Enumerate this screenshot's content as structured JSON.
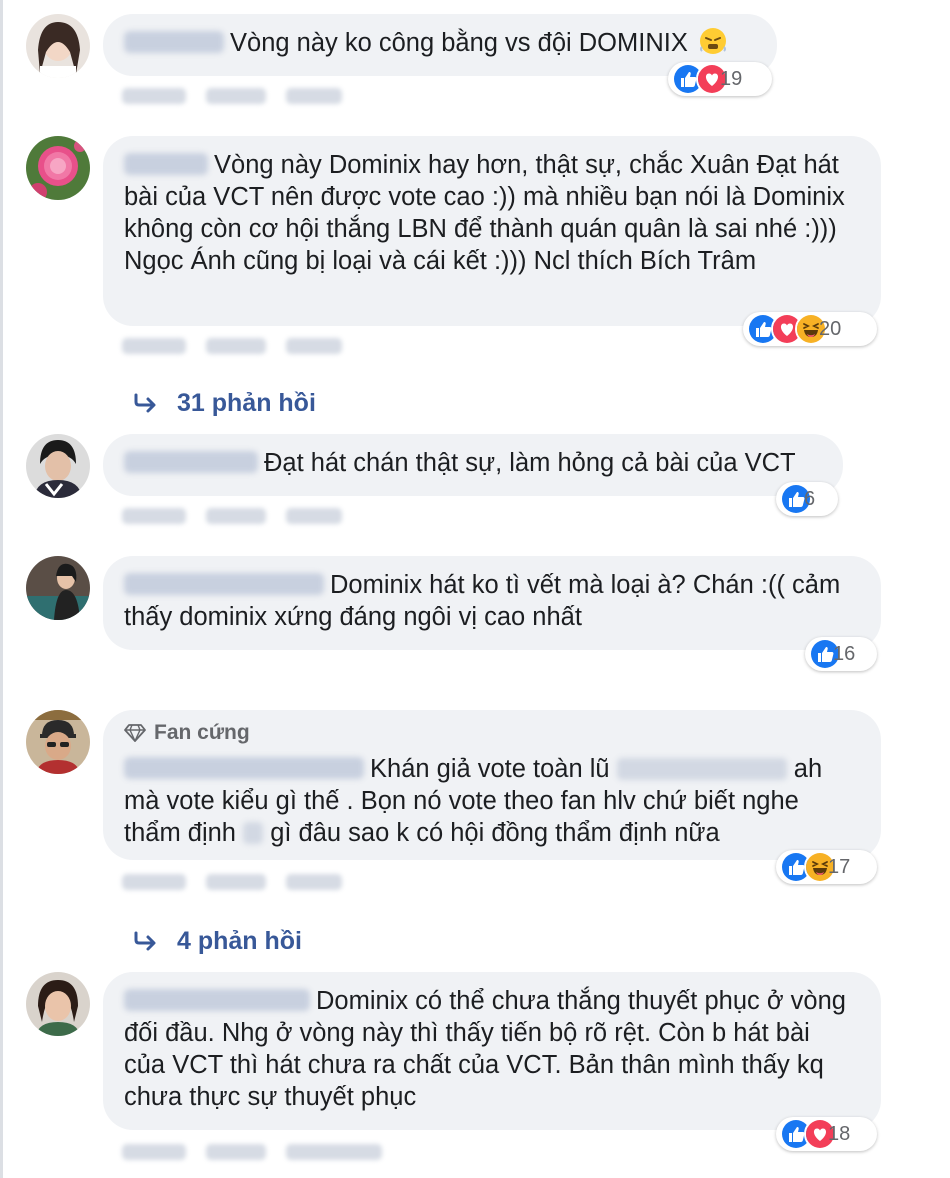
{
  "comments": [
    {
      "text": "Vòng này ko công bằng vs đội DOMINIX",
      "reaction_count": "19",
      "reactions": [
        "like-icon",
        "love-icon"
      ]
    },
    {
      "text": "Vòng này Dominix hay hơn, thật sự, chắc Xuân Đạt hát bài của VCT nên được vote cao :)) mà nhiều bạn nói là Dominix không còn cơ hội thắng LBN để thành quán quân là sai nhé :))) Ngọc Ánh cũng bị loại và cái kết :))) Ncl thích Bích Trâm",
      "reaction_count": "20",
      "reactions": [
        "like-icon",
        "love-icon",
        "haha-icon"
      ],
      "replies_label": "31 phản hồi"
    },
    {
      "text": "Đạt hát chán thật sự, làm hỏng cả bài của VCT",
      "reaction_count": "6",
      "reactions": [
        "like-icon"
      ]
    },
    {
      "text": "Dominix hát ko tì vết mà loại à? Chán :(( cảm thấy dominix xứng đáng ngôi vị cao nhất",
      "reaction_count": "16",
      "reactions": [
        "like-icon"
      ]
    },
    {
      "badge": "Fan cứng",
      "text_a": "Khán giả vote toàn lũ",
      "text_b": "ah mà vote kiểu gì thế . Bọn nó vote theo fan hlv chứ biết nghe thẩm định",
      "text_c": "gì đâu sao k có hội đồng thẩm định nữa",
      "reaction_count": "17",
      "reactions": [
        "like-icon",
        "haha-icon"
      ],
      "replies_label": "4 phản hồi"
    },
    {
      "text": "Dominix có thể chưa thắng thuyết phục ở vòng đối đầu. Nhg ở vòng này thì thấy tiến bộ rõ rệt. Còn b hát bài của VCT thì hát chưa ra chất của VCT. Bản thân mình thấy kq chưa thực sự thuyết phục",
      "reaction_count": "18",
      "reactions": [
        "like-icon",
        "love-icon"
      ]
    }
  ],
  "colors": {
    "bubble_bg": "#f0f2f5",
    "link_blue": "#385898",
    "like_blue": "#1877f2",
    "love_red": "#f33e58",
    "haha_yellow": "#f7b125",
    "meta_gray": "#65676b"
  }
}
